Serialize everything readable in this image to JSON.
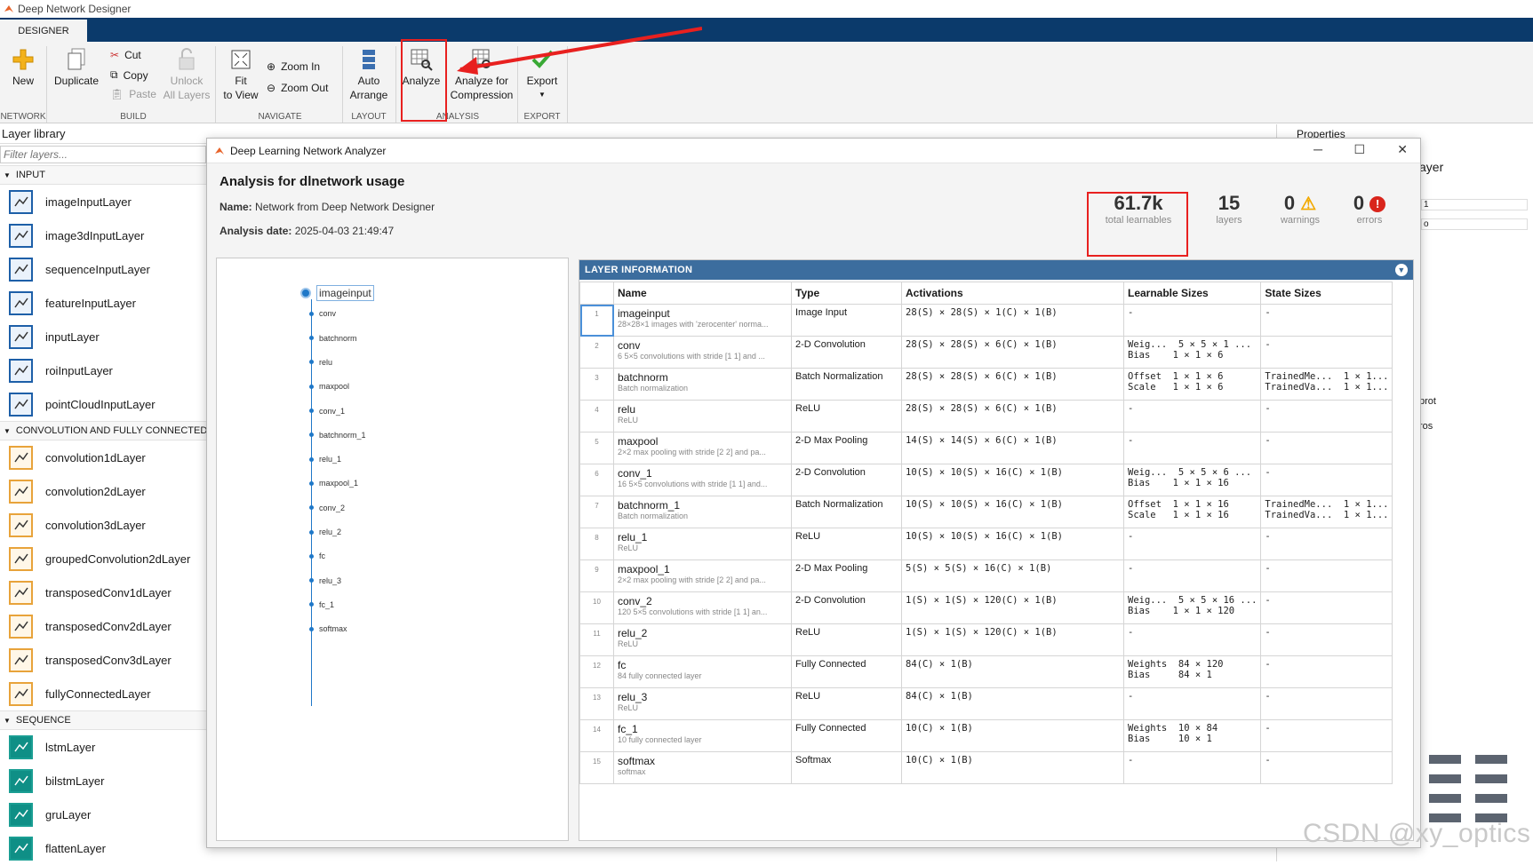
{
  "window": {
    "title": "Deep Network Designer"
  },
  "ribbon": {
    "tab": "DESIGNER",
    "buttons": {
      "new": "New",
      "duplicate": "Duplicate",
      "cut": "Cut",
      "copy": "Copy",
      "paste": "Paste",
      "unlock_line1": "Unlock",
      "unlock_line2": "All Layers",
      "fit_line1": "Fit",
      "fit_line2": "to View",
      "zoom_in": "Zoom In",
      "zoom_out": "Zoom Out",
      "auto_line1": "Auto",
      "auto_line2": "Arrange",
      "analyze": "Analyze",
      "analyze_comp_line1": "Analyze for",
      "analyze_comp_line2": "Compression",
      "export": "Export"
    },
    "groups": {
      "network": "NETWORK",
      "build": "BUILD",
      "navigate": "NAVIGATE",
      "layout": "LAYOUT",
      "analysis": "ANALYSIS",
      "export": "EXPORT"
    }
  },
  "layer_library": {
    "title": "Layer library",
    "filter_placeholder": "Filter layers...",
    "sections": [
      {
        "title": "INPUT",
        "items": [
          "imageInputLayer",
          "image3dInputLayer",
          "sequenceInputLayer",
          "featureInputLayer",
          "inputLayer",
          "roiInputLayer",
          "pointCloudInputLayer"
        ]
      },
      {
        "title": "CONVOLUTION AND FULLY CONNECTED",
        "items": [
          "convolution1dLayer",
          "convolution2dLayer",
          "convolution3dLayer",
          "groupedConvolution2dLayer",
          "transposedConv1dLayer",
          "transposedConv2dLayer",
          "transposedConv3dLayer",
          "fullyConnectedLayer"
        ]
      },
      {
        "title": "SEQUENCE",
        "items": [
          "lstmLayer",
          "bilstmLayer",
          "gruLayer",
          "flattenLayer"
        ]
      }
    ]
  },
  "background_right": {
    "properties": "Properties",
    "fragments": [
      "ayer",
      "1",
      "o",
      "prot",
      "ros"
    ]
  },
  "dialog": {
    "title": "Deep Learning Network Analyzer",
    "heading": "Analysis for dlnetwork usage",
    "name_label": "Name:",
    "name_value": "Network from Deep Network Designer",
    "date_label": "Analysis date:",
    "date_value": "2025-04-03 21:49:47",
    "stats": [
      {
        "value": "61.7k",
        "label": "total learnables"
      },
      {
        "value": "15",
        "label": "layers"
      },
      {
        "value": "0",
        "label": "warnings"
      },
      {
        "value": "0",
        "label": "errors"
      }
    ],
    "graph_nodes": [
      "imageinput",
      "conv",
      "batchnorm",
      "relu",
      "maxpool",
      "conv_1",
      "batchnorm_1",
      "relu_1",
      "maxpool_1",
      "conv_2",
      "relu_2",
      "fc",
      "relu_3",
      "fc_1",
      "softmax"
    ],
    "table_title": "LAYER INFORMATION",
    "columns": [
      "",
      "Name",
      "Type",
      "Activations",
      "Learnable Sizes",
      "State Sizes"
    ],
    "rows": [
      {
        "i": "1",
        "name": "imageinput",
        "desc": "28×28×1 images with 'zerocenter' norma...",
        "type": "Image Input",
        "act": "28(S) × 28(S) × 1(C) × 1(B)",
        "learn": [
          "-"
        ],
        "state": [
          "-"
        ]
      },
      {
        "i": "2",
        "name": "conv",
        "desc": "6 5×5 convolutions with stride [1 1] and ...",
        "type": "2-D Convolution",
        "act": "28(S) × 28(S) × 6(C) × 1(B)",
        "learn": [
          "Weig...  5 × 5 × 1 ...",
          "Bias    1 × 1 × 6"
        ],
        "state": [
          "-"
        ]
      },
      {
        "i": "3",
        "name": "batchnorm",
        "desc": "Batch normalization",
        "type": "Batch Normalization",
        "act": "28(S) × 28(S) × 6(C) × 1(B)",
        "learn": [
          "Offset  1 × 1 × 6",
          "Scale   1 × 1 × 6"
        ],
        "state": [
          "TrainedMe...  1 × 1...",
          "TrainedVa...  1 × 1..."
        ]
      },
      {
        "i": "4",
        "name": "relu",
        "desc": "ReLU",
        "type": "ReLU",
        "act": "28(S) × 28(S) × 6(C) × 1(B)",
        "learn": [
          "-"
        ],
        "state": [
          "-"
        ]
      },
      {
        "i": "5",
        "name": "maxpool",
        "desc": "2×2 max pooling with stride [2 2] and pa...",
        "type": "2-D Max Pooling",
        "act": "14(S) × 14(S) × 6(C) × 1(B)",
        "learn": [
          "-"
        ],
        "state": [
          "-"
        ]
      },
      {
        "i": "6",
        "name": "conv_1",
        "desc": "16 5×5 convolutions with stride [1 1] and...",
        "type": "2-D Convolution",
        "act": "10(S) × 10(S) × 16(C) × 1(B)",
        "learn": [
          "Weig...  5 × 5 × 6 ...",
          "Bias    1 × 1 × 16"
        ],
        "state": [
          "-"
        ]
      },
      {
        "i": "7",
        "name": "batchnorm_1",
        "desc": "Batch normalization",
        "type": "Batch Normalization",
        "act": "10(S) × 10(S) × 16(C) × 1(B)",
        "learn": [
          "Offset  1 × 1 × 16",
          "Scale   1 × 1 × 16"
        ],
        "state": [
          "TrainedMe...  1 × 1...",
          "TrainedVa...  1 × 1..."
        ]
      },
      {
        "i": "8",
        "name": "relu_1",
        "desc": "ReLU",
        "type": "ReLU",
        "act": "10(S) × 10(S) × 16(C) × 1(B)",
        "learn": [
          "-"
        ],
        "state": [
          "-"
        ]
      },
      {
        "i": "9",
        "name": "maxpool_1",
        "desc": "2×2 max pooling with stride [2 2] and pa...",
        "type": "2-D Max Pooling",
        "act": "5(S) × 5(S) × 16(C) × 1(B)",
        "learn": [
          "-"
        ],
        "state": [
          "-"
        ]
      },
      {
        "i": "10",
        "name": "conv_2",
        "desc": "120 5×5 convolutions with stride [1 1] an...",
        "type": "2-D Convolution",
        "act": "1(S) × 1(S) × 120(C) × 1(B)",
        "learn": [
          "Weig...  5 × 5 × 16 ...",
          "Bias    1 × 1 × 120"
        ],
        "state": [
          "-"
        ]
      },
      {
        "i": "11",
        "name": "relu_2",
        "desc": "ReLU",
        "type": "ReLU",
        "act": "1(S) × 1(S) × 120(C) × 1(B)",
        "learn": [
          "-"
        ],
        "state": [
          "-"
        ]
      },
      {
        "i": "12",
        "name": "fc",
        "desc": "84 fully connected layer",
        "type": "Fully Connected",
        "act": "84(C) × 1(B)",
        "learn": [
          "Weights  84 × 120",
          "Bias     84 × 1"
        ],
        "state": [
          "-"
        ]
      },
      {
        "i": "13",
        "name": "relu_3",
        "desc": "ReLU",
        "type": "ReLU",
        "act": "84(C) × 1(B)",
        "learn": [
          "-"
        ],
        "state": [
          "-"
        ]
      },
      {
        "i": "14",
        "name": "fc_1",
        "desc": "10 fully connected layer",
        "type": "Fully Connected",
        "act": "10(C) × 1(B)",
        "learn": [
          "Weights  10 × 84",
          "Bias     10 × 1"
        ],
        "state": [
          "-"
        ]
      },
      {
        "i": "15",
        "name": "softmax",
        "desc": "softmax",
        "type": "Softmax",
        "act": "10(C) × 1(B)",
        "learn": [
          "-"
        ],
        "state": [
          "-"
        ]
      }
    ]
  },
  "watermark": "CSDN @xy_optics",
  "colors": {
    "ribbon_blue": "#0b3a6b",
    "table_header": "#3c6d9e",
    "annotation_red": "#e8201f",
    "warning": "#f2a900",
    "error": "#d9251c"
  }
}
